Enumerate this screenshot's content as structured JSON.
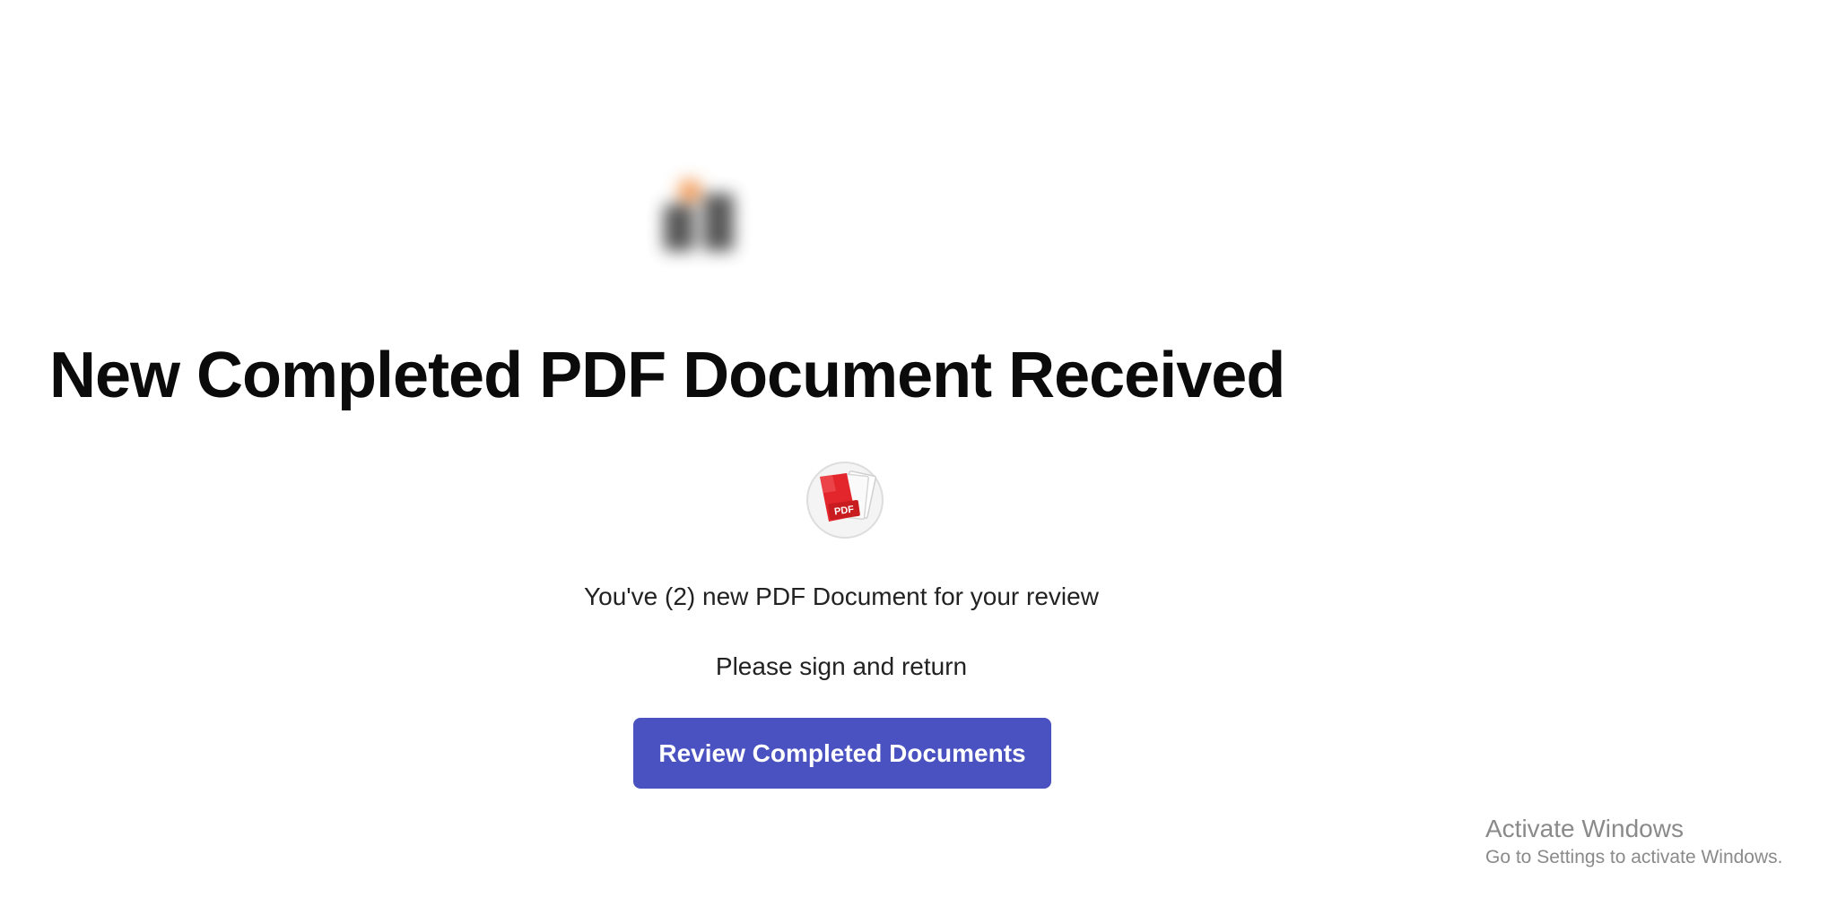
{
  "email": {
    "title": "New Completed PDF Document Received",
    "message_line1": "You've (2) new PDF Document for your review",
    "message_line2": "Please sign and return",
    "cta_label": "Review Completed Documents",
    "logo_icon": "blurred-company-logo",
    "document_icon": "pdf-document-icon",
    "pdf_badge_text": "PDF"
  },
  "os_watermark": {
    "title": "Activate Windows",
    "subtitle": "Go to Settings to activate Windows."
  },
  "colors": {
    "background": "#ffffff",
    "title": "#0b0b0b",
    "body_text": "#222222",
    "button": "#4a51c0",
    "button_text": "#ffffff",
    "pdf_red": "#e3262b",
    "watermark": "#8a8a8a"
  }
}
